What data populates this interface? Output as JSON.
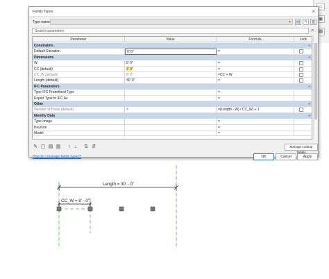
{
  "dialog": {
    "title": "Family Types",
    "type_name_label": "Type name:",
    "type_name_value": "",
    "search_placeholder": "Search parameters"
  },
  "columns": {
    "parameter": "Parameter",
    "value": "Value",
    "formula": "Formula",
    "lock": "Lock"
  },
  "rows": [
    {
      "kind": "group",
      "label": "Constraints",
      "collapse": "«"
    },
    {
      "kind": "param",
      "name": "Default Elevation",
      "value": "0' 0\"",
      "formula": "=",
      "lock": true,
      "editing": true
    },
    {
      "kind": "group",
      "label": "Dimensions",
      "collapse": "«"
    },
    {
      "kind": "param",
      "name": "W",
      "value": "5' 0\"",
      "formula": "=",
      "lock": true
    },
    {
      "kind": "param",
      "name": "CC (default)",
      "value": "3' 0\"",
      "formula": "=",
      "lock": true,
      "highlight": true
    },
    {
      "kind": "param",
      "name": "CC_W (default)",
      "value": "8' 0\"",
      "formula": "=CC + W",
      "lock": false,
      "grey": true
    },
    {
      "kind": "param",
      "name": "Length (default)",
      "value": "30' 0\"",
      "formula": "=",
      "lock": true
    },
    {
      "kind": "group",
      "label": "IFC Parameters",
      "collapse": "«"
    },
    {
      "kind": "param",
      "name": "Type IFC Predefined Type",
      "value": "",
      "formula": "=",
      "lock": false
    },
    {
      "kind": "param",
      "name": "Export Type to IFC As",
      "value": "",
      "formula": "=",
      "lock": false
    },
    {
      "kind": "group",
      "label": "Other",
      "collapse": "«"
    },
    {
      "kind": "param",
      "name": "Number of Posts (default)",
      "value": "4",
      "formula": "=(Length - W) / CC_W) + 1",
      "lock": true,
      "grey": true
    },
    {
      "kind": "group",
      "label": "Identity Data",
      "collapse": "«"
    },
    {
      "kind": "param",
      "name": "Type Image",
      "value": "",
      "formula": "=",
      "lock": false
    },
    {
      "kind": "param",
      "name": "Keynote",
      "value": "",
      "formula": "=",
      "lock": false
    },
    {
      "kind": "param",
      "name": "Model",
      "value": "",
      "formula": "=",
      "lock": false
    }
  ],
  "toolbar": {
    "icons": [
      "pencil-icon",
      "new-type-icon",
      "rename-icon",
      "delete-icon",
      "move-up-icon",
      "move-down-icon",
      "sort-ascending-icon",
      "sort-descending-icon"
    ],
    "manage_lookup_label": "Manage Lookup Tables"
  },
  "help_link": "How do I manage family types?",
  "buttons": {
    "ok": "OK",
    "cancel": "Cancel",
    "apply": "Apply"
  },
  "drawing": {
    "length_label": "Length = 30' - 0\"",
    "ccw_label": "CC_W = 8' - 0\""
  },
  "colors": {
    "group_bg": "#c7d6e8",
    "highlight": "#fff79a",
    "ref_line": "#4cb84c",
    "link": "#1f5fbf"
  }
}
